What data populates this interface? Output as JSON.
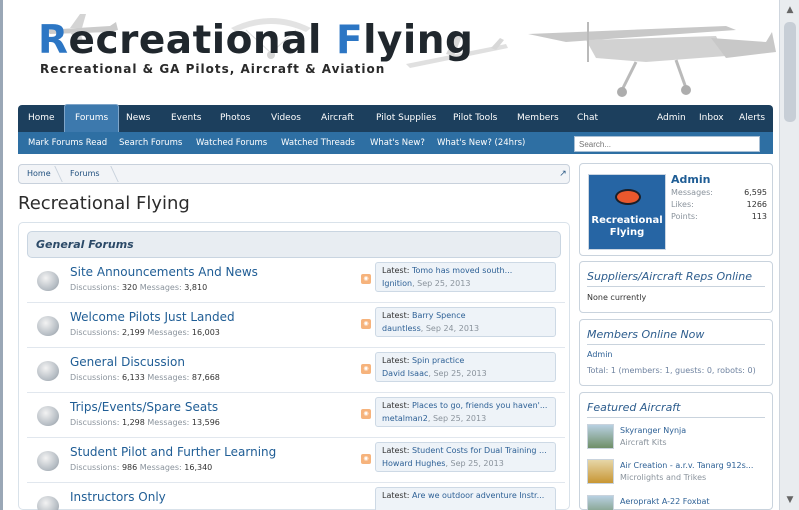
{
  "header": {
    "logo_part1": "R",
    "logo_part2": "ecreational ",
    "logo_part3": "F",
    "logo_part4": "lying",
    "tagline": "Recreational & GA Pilots, Aircraft & Aviation"
  },
  "nav": {
    "items": [
      "Home",
      "Forums",
      "News",
      "Events",
      "Photos",
      "Videos",
      "Aircraft",
      "Pilot Supplies",
      "Pilot Tools",
      "Members",
      "Chat"
    ],
    "active": "Forums",
    "right_items": [
      "Admin",
      "Inbox",
      "Alerts"
    ]
  },
  "subnav": {
    "items": [
      "Mark Forums Read",
      "Search Forums",
      "Watched Forums",
      "Watched Threads",
      "What's New?",
      "What's New? (24hrs)"
    ],
    "search_placeholder": "Search..."
  },
  "breadcrumb": [
    "Home",
    "Forums"
  ],
  "page_title": "Recreational Flying",
  "section": {
    "title": "General Forums",
    "forums": [
      {
        "title": "Site Announcements And News",
        "discussions": "320",
        "messages": "3,810",
        "latest_title": "Tomo has moved south...",
        "latest_user": "Ignition",
        "latest_date": "Sep 25, 2013"
      },
      {
        "title": "Welcome Pilots Just Landed",
        "discussions": "2,199",
        "messages": "16,003",
        "latest_title": "Barry Spence",
        "latest_user": "dauntless",
        "latest_date": "Sep 24, 2013"
      },
      {
        "title": "General Discussion",
        "discussions": "6,133",
        "messages": "87,668",
        "latest_title": "Spin practice",
        "latest_user": "David Isaac",
        "latest_date": "Sep 25, 2013"
      },
      {
        "title": "Trips/Events/Spare Seats",
        "discussions": "1,298",
        "messages": "13,596",
        "latest_title": "Places to go, friends you haven'...",
        "latest_user": "metalman2",
        "latest_date": "Sep 25, 2013"
      },
      {
        "title": "Student Pilot and Further Learning",
        "discussions": "986",
        "messages": "16,340",
        "latest_title": "Student Costs for Dual Training ...",
        "latest_user": "Howard Hughes",
        "latest_date": "Sep 25, 2013"
      },
      {
        "title": "Instructors Only",
        "discussions": "",
        "messages": "",
        "latest_title": "Are we outdoor adventure Instr...",
        "latest_user": "",
        "latest_date": ""
      }
    ],
    "discussions_label": "Discussions:",
    "messages_label": "Messages:",
    "latest_label": "Latest:"
  },
  "user_box": {
    "name": "Admin",
    "avatar_text": "Recreational Flying",
    "stats": [
      {
        "label": "Messages:",
        "value": "6,595"
      },
      {
        "label": "Likes:",
        "value": "1266"
      },
      {
        "label": "Points:",
        "value": "113"
      }
    ]
  },
  "suppliers": {
    "title": "Suppliers/Aircraft Reps Online",
    "text": "None currently"
  },
  "members_online": {
    "title": "Members Online Now",
    "member": "Admin",
    "summary": "Total: 1 (members: 1, guests: 0, robots: 0)"
  },
  "featured": {
    "title": "Featured Aircraft",
    "items": [
      {
        "name": "Skyranger Nynja",
        "category": "Aircraft Kits"
      },
      {
        "name": "Air Creation - a.r.v. Tanarg 912s...",
        "category": "Microlights and Trikes"
      },
      {
        "name": "Aeroprakt A-22 Foxbat",
        "category": ""
      }
    ]
  }
}
